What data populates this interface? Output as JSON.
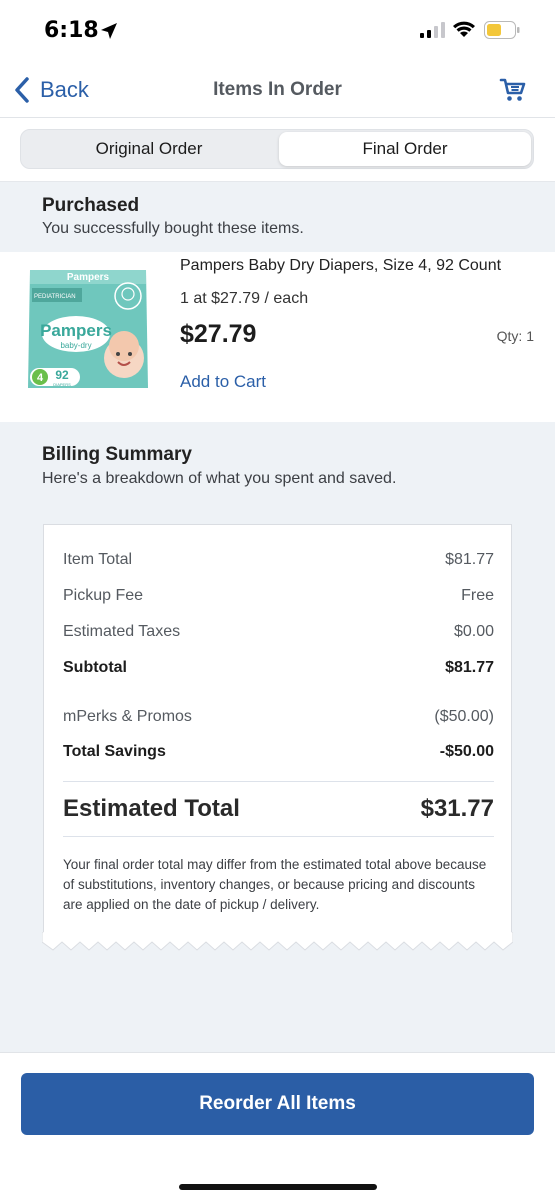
{
  "status_bar": {
    "time": "6:18",
    "icons": [
      "location-arrow-icon",
      "signal-icon",
      "wifi-icon",
      "battery-icon"
    ]
  },
  "nav": {
    "back_label": "Back",
    "title": "Items In Order",
    "cart_icon": "cart-icon"
  },
  "tabs": [
    {
      "label": "Original Order",
      "selected": false
    },
    {
      "label": "Final Order",
      "selected": true
    }
  ],
  "purchased": {
    "title": "Purchased",
    "subtitle": "You successfully bought these items."
  },
  "product": {
    "name": "Pampers Baby Dry Diapers, Size 4, 92 Count",
    "unit_price": "1 at $27.79 / each",
    "price": "$27.79",
    "qty": "Qty: 1",
    "add_to_cart": "Add to Cart",
    "image": {
      "brand": "Pampers",
      "variant": "baby-dry",
      "top_text": "Pampers",
      "badge": "PEDIATRICIAN",
      "size": "4",
      "count": "92",
      "count_label": "DIAPERS"
    }
  },
  "billing": {
    "title": "Billing Summary",
    "subtitle": "Here's a breakdown of what you spent and saved.",
    "rows": [
      {
        "label": "Item Total",
        "value": "$81.77"
      },
      {
        "label": "Pickup Fee",
        "value": "Free"
      },
      {
        "label": "Estimated Taxes",
        "value": "$0.00"
      },
      {
        "label": "Subtotal",
        "value": "$81.77"
      },
      {
        "label": "mPerks & Promos",
        "value": "($50.00)"
      },
      {
        "label": "Total Savings",
        "value": "-$50.00"
      }
    ],
    "estimated_total_label": "Estimated Total",
    "estimated_total_value": "$31.77",
    "note": "Your final order total may differ from the estimated total above because of substitutions, inventory changes, or because pricing and discounts are applied on the date of pickup / delivery."
  },
  "reorder_button": "Reorder All Items",
  "colors": {
    "accent": "#2b5ea6",
    "link": "#2b5fa8",
    "section_bg": "#eef2f6"
  }
}
